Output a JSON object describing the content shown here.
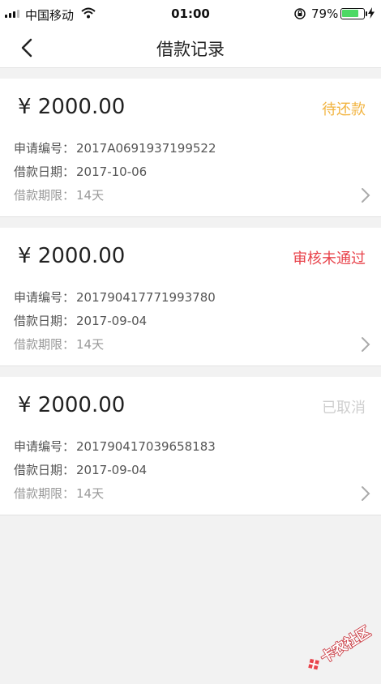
{
  "status_bar": {
    "carrier": "中国移动",
    "time": "01:00",
    "battery_percent": "79%",
    "battery_level": 0.79
  },
  "nav": {
    "title": "借款记录"
  },
  "labels": {
    "apply_no": "申请编号：",
    "loan_date": "借款日期：",
    "loan_term": "借款期限："
  },
  "records": [
    {
      "amount": "¥ 2000.00",
      "status": "待还款",
      "apply_no": "2017A0691937199522",
      "loan_date": "2017-10-06",
      "term": "14天"
    },
    {
      "amount": "¥ 2000.00",
      "status": "审核未通过",
      "apply_no": "201790417771993780",
      "loan_date": "2017-09-04",
      "term": "14天"
    },
    {
      "amount": "¥ 2000.00",
      "status": "已取消",
      "apply_no": "201790417039658183",
      "loan_date": "2017-09-04",
      "term": "14天"
    }
  ],
  "colors": {
    "pending": "#f2b441",
    "rejected": "#e8424a",
    "cancelled": "#cfcfcf"
  },
  "watermark": {
    "text": "卡农社区"
  }
}
